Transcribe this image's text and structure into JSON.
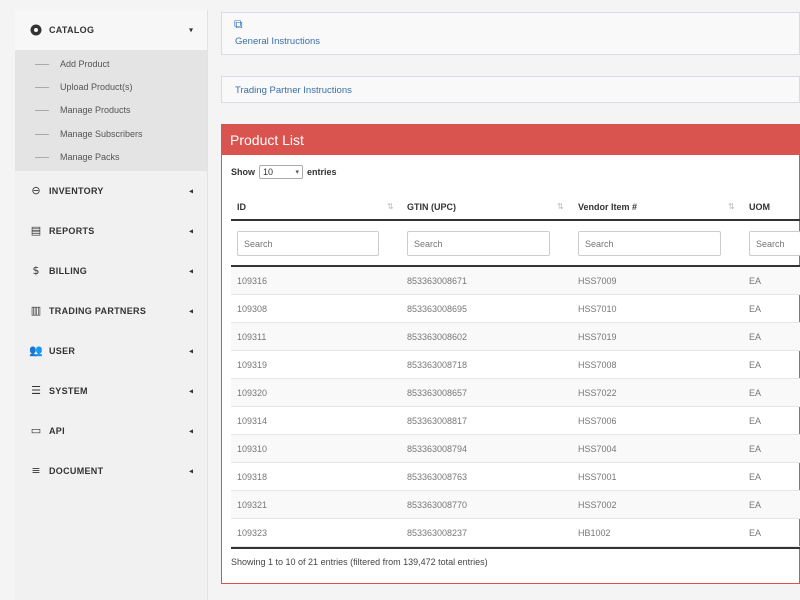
{
  "sidebar": {
    "catalog": {
      "label": "CATALOG",
      "icon": "catalog-icon",
      "arrow": "▾"
    },
    "subitems": [
      {
        "label": "Add Product"
      },
      {
        "label": "Upload Product(s)"
      },
      {
        "label": "Manage Products"
      },
      {
        "label": "Manage Subscribers"
      },
      {
        "label": "Manage Packs"
      }
    ],
    "items": [
      {
        "label": "INVENTORY",
        "icon": "inventory-icon",
        "glyph": "⊖"
      },
      {
        "label": "REPORTS",
        "icon": "reports-icon",
        "glyph": "▤"
      },
      {
        "label": "BILLING",
        "icon": "billing-icon",
        "glyph": "$"
      },
      {
        "label": "TRADING PARTNERS",
        "icon": "building-icon",
        "glyph": "▥"
      },
      {
        "label": "USER",
        "icon": "users-icon",
        "glyph": "👥"
      },
      {
        "label": "SYSTEM",
        "icon": "database-icon",
        "glyph": "☰"
      },
      {
        "label": "API",
        "icon": "monitor-icon",
        "glyph": "▭"
      },
      {
        "label": "DOCUMENT",
        "icon": "list-icon",
        "glyph": "≡"
      }
    ],
    "collapsed_arrow": "◂"
  },
  "instructions": {
    "general_label": "General Instructions",
    "trading_label": "Trading Partner Instructions"
  },
  "product_list": {
    "title": "Product List",
    "show_label": "Show",
    "entries_label": "entries",
    "page_size": "10",
    "columns": [
      "ID",
      "GTIN (UPC)",
      "Vendor Item #",
      "UOM"
    ],
    "search_placeholder": "Search",
    "rows": [
      {
        "id": "109316",
        "gtin": "853363008671",
        "vendor": "HSS7009",
        "uom": "EA"
      },
      {
        "id": "109308",
        "gtin": "853363008695",
        "vendor": "HSS7010",
        "uom": "EA"
      },
      {
        "id": "109311",
        "gtin": "853363008602",
        "vendor": "HSS7019",
        "uom": "EA"
      },
      {
        "id": "109319",
        "gtin": "853363008718",
        "vendor": "HSS7008",
        "uom": "EA"
      },
      {
        "id": "109320",
        "gtin": "853363008657",
        "vendor": "HSS7022",
        "uom": "EA"
      },
      {
        "id": "109314",
        "gtin": "853363008817",
        "vendor": "HSS7006",
        "uom": "EA"
      },
      {
        "id": "109310",
        "gtin": "853363008794",
        "vendor": "HSS7004",
        "uom": "EA"
      },
      {
        "id": "109318",
        "gtin": "853363008763",
        "vendor": "HSS7001",
        "uom": "EA"
      },
      {
        "id": "109321",
        "gtin": "853363008770",
        "vendor": "HSS7002",
        "uom": "EA"
      },
      {
        "id": "109323",
        "gtin": "853363008237",
        "vendor": "HB1002",
        "uom": "EA"
      }
    ],
    "info": "Showing 1 to 10 of 21 entries (filtered from 139,472 total entries)"
  },
  "colors": {
    "panel_accent": "#d9534f",
    "link": "#3a6fa8"
  }
}
